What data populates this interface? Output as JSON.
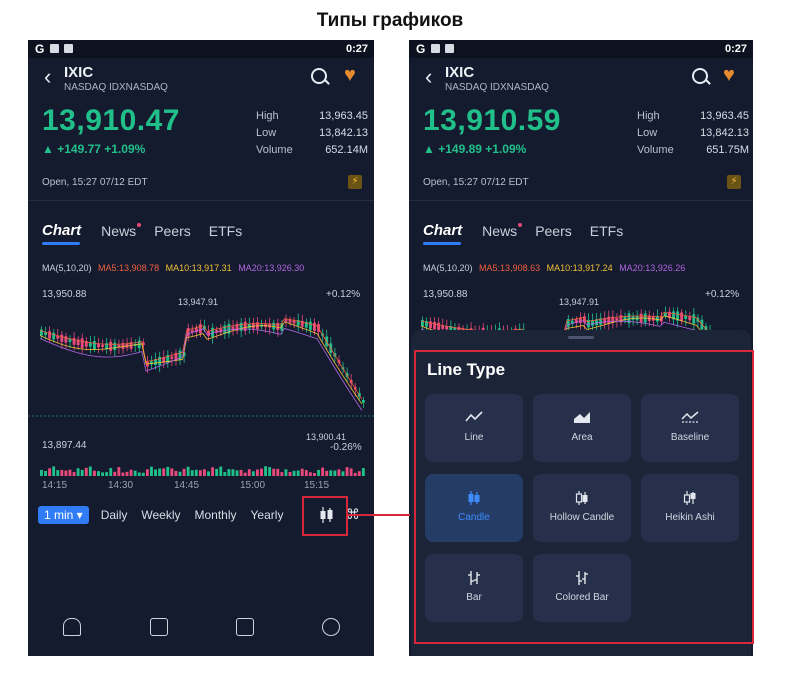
{
  "page_title": "Типы графиков",
  "left": {
    "status": {
      "g": "G",
      "time": "0:27"
    },
    "symbol": "IXIC",
    "exchange": "NASDAQ IDXNASDAQ",
    "price": "13,910.47",
    "change": "▲ +149.77 +1.09%",
    "high_label": "High",
    "high": "13,963.45",
    "low_label": "Low",
    "low": "13,842.13",
    "volume_label": "Volume",
    "volume": "652.14M",
    "open_text": "Open, 15:27 07/12 EDT",
    "tabs": {
      "chart": "Chart",
      "news": "News",
      "peers": "Peers",
      "etfs": "ETFs"
    },
    "ma": {
      "label": "MA(5,10,20)",
      "ma5": "MA5:13,908.78",
      "ma10": "MA10:13,917.31",
      "ma20": "MA20:13,926.30"
    },
    "chart_max": "13,950.88",
    "chart_high_marker": "13,947.91",
    "chart_pct_top": "+0.12%",
    "chart_min": "13,897.44",
    "chart_last_marker": "13,900.41",
    "chart_pct_bottom": "-0.26%",
    "time_axis": [
      "14:15",
      "14:30",
      "14:45",
      "15:00",
      "15:15"
    ],
    "time_buttons": {
      "min": "1 min ▾",
      "daily": "Daily",
      "weekly": "Weekly",
      "monthly": "Monthly",
      "yearly": "Yearly"
    }
  },
  "right": {
    "status": {
      "g": "G",
      "time": "0:27"
    },
    "symbol": "IXIC",
    "exchange": "NASDAQ IDXNASDAQ",
    "price": "13,910.59",
    "change": "▲ +149.89 +1.09%",
    "high_label": "High",
    "high": "13,963.45",
    "low_label": "Low",
    "low": "13,842.13",
    "volume_label": "Volume",
    "volume": "651.75M",
    "open_text": "Open, 15:27 07/12 EDT",
    "tabs": {
      "chart": "Chart",
      "news": "News",
      "peers": "Peers",
      "etfs": "ETFs"
    },
    "ma": {
      "label": "MA(5,10,20)",
      "ma5": "MA5:13,908.63",
      "ma10": "MA10:13,917.24",
      "ma20": "MA20:13,926.26"
    },
    "chart_max": "13,950.88",
    "chart_high_marker": "13,947.91",
    "chart_pct_top": "+0.12%",
    "sheet": {
      "title": "Line Type",
      "options": [
        {
          "label": "Line",
          "icon": "line-chart-icon",
          "selected": false
        },
        {
          "label": "Area",
          "icon": "area-chart-icon",
          "selected": false
        },
        {
          "label": "Baseline",
          "icon": "baseline-chart-icon",
          "selected": false
        },
        {
          "label": "Candle",
          "icon": "candle-icon",
          "selected": true
        },
        {
          "label": "Hollow Candle",
          "icon": "hollow-candle-icon",
          "selected": false
        },
        {
          "label": "Heikin Ashi",
          "icon": "heikin-ashi-icon",
          "selected": false
        },
        {
          "label": "Bar",
          "icon": "bar-ohlc-icon",
          "selected": false
        },
        {
          "label": "Colored Bar",
          "icon": "colored-bar-icon",
          "selected": false
        }
      ]
    }
  },
  "colors": {
    "up": "#21c08b",
    "down": "#e84a7a",
    "accent": "#2f7cf6",
    "highlight": "#d6283a",
    "ma5": "#f0603f",
    "ma10": "#f2c037",
    "ma20": "#b066e0"
  }
}
